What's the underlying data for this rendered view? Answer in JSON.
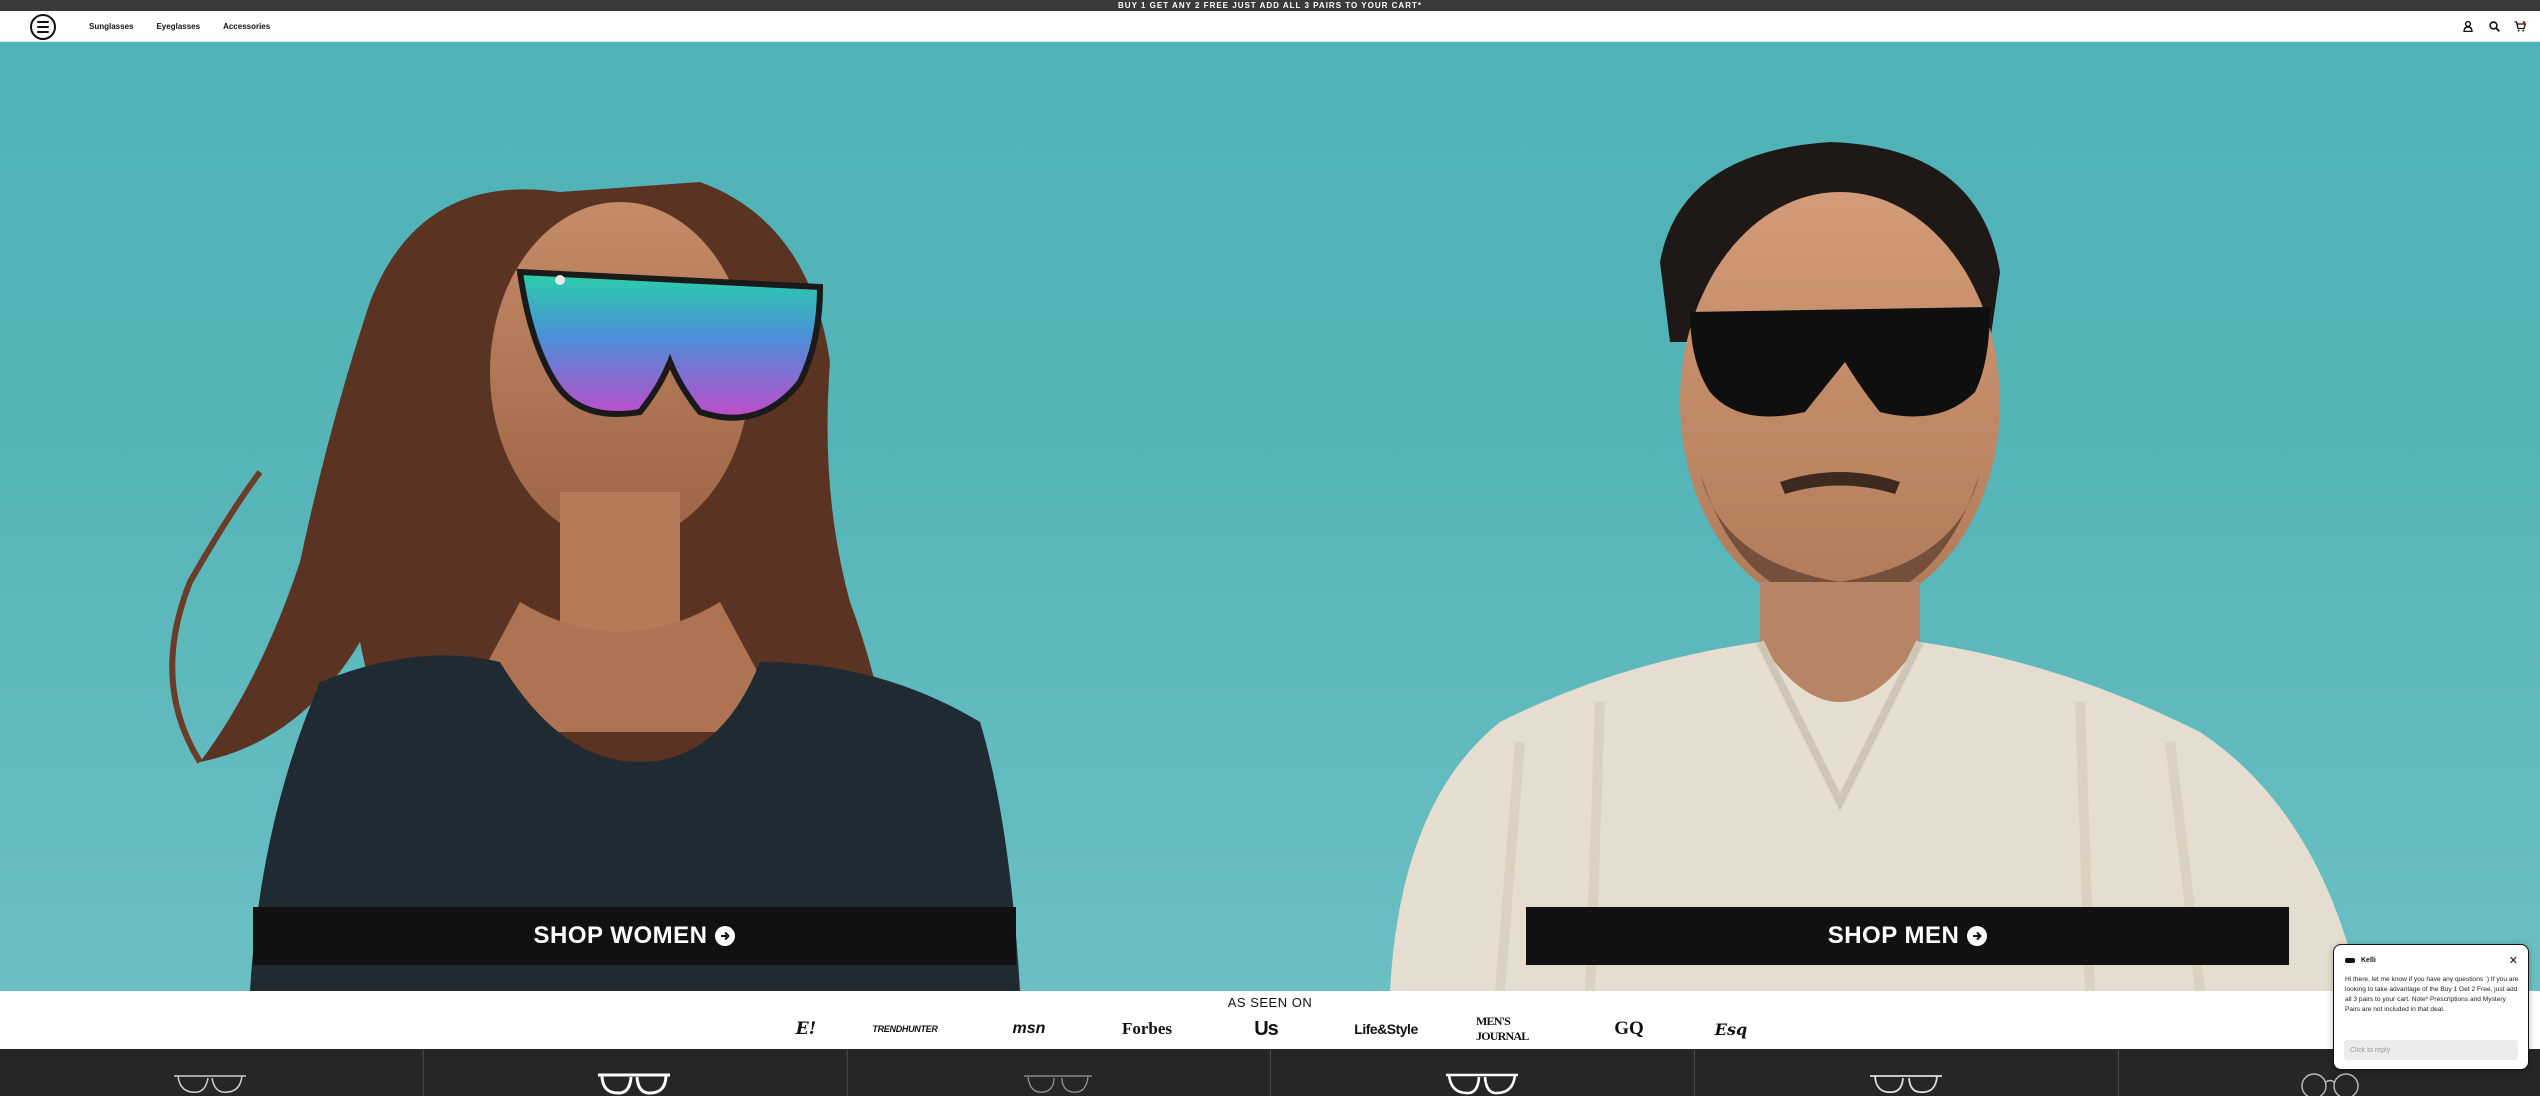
{
  "promo": {
    "text": "BUY 1 GET ANY 2 FREE JUST ADD ALL 3 PAIRS TO YOUR CART*"
  },
  "nav": {
    "logo": "menu-logo-icon",
    "links": [
      {
        "label": "Sunglasses"
      },
      {
        "label": "Eyeglasses"
      },
      {
        "label": "Accessories"
      }
    ],
    "icons": [
      "account-icon",
      "search-icon",
      "cart-icon"
    ],
    "cart_count": ""
  },
  "hero": {
    "shop_women": "SHOP WOMEN",
    "shop_men": "SHOP MEN",
    "colors": {
      "sky": "#54b4b8",
      "button": "#111111"
    }
  },
  "press": {
    "title": "AS SEEN ON",
    "logos": [
      "E!",
      "TRENDHUNTER",
      "msn",
      "Forbes",
      "Us",
      "Life&Style",
      "MEN'S JOURNAL",
      "GQ",
      "Esq"
    ]
  },
  "products": {
    "icons": [
      "sunglasses-icon",
      "eyeglasses-icon",
      "aviator-icon",
      "sunglasses-icon",
      "eyeglasses-icon",
      "round-glasses-icon"
    ]
  },
  "chat": {
    "agent_name": "Kelli",
    "message": "Hi there, let me know if you have any questions :) If you are looking to take advantage of the Buy 1 Get 2 Free, just add all 3 pairs to your cart. Note* Prescriptions and Mystery Pairs are not included in that deal.",
    "input_placeholder": "Click to reply"
  }
}
